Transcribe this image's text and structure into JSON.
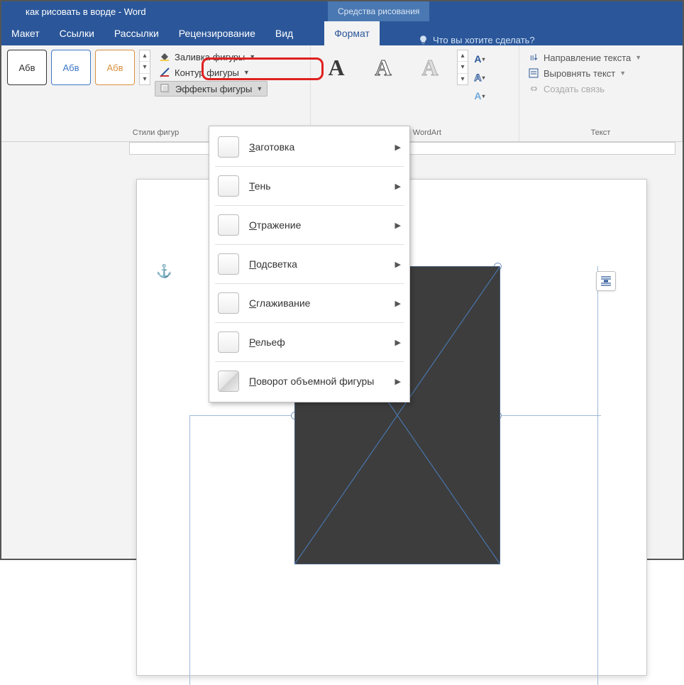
{
  "title": "как рисовать в ворде - Word",
  "context_tab": "Средства рисования",
  "tabs": {
    "layout": "Макет",
    "references": "Ссылки",
    "mailings": "Рассылки",
    "review": "Рецензирование",
    "view": "Вид",
    "format": "Формат"
  },
  "tell_me": "Что вы хотите сделать?",
  "ribbon": {
    "styles_group": "Стили фигур",
    "wordart_group": "Стили WordArt",
    "text_group": "Текст",
    "thumb_text": "Абв",
    "fill": "Заливка фигуры",
    "outline": "Контур фигуры",
    "effects": "Эффекты фигуры",
    "wa_letter": "А",
    "text_direction": "Направление текста",
    "align_text": "Выровнять текст",
    "create_link": "Создать связь"
  },
  "effects_menu": {
    "preset": "Заготовка",
    "shadow": "Тень",
    "reflection": "Отражение",
    "glow": "Подсветка",
    "soft_edges": "Сглаживание",
    "bevel": "Рельеф",
    "rotation3d": "Поворот объемной фигуры",
    "u_preset": "З",
    "u_shadow": "Т",
    "u_reflection": "О",
    "u_glow": "П",
    "u_soft": "С",
    "u_bevel": "Р",
    "u_rot": "П"
  }
}
